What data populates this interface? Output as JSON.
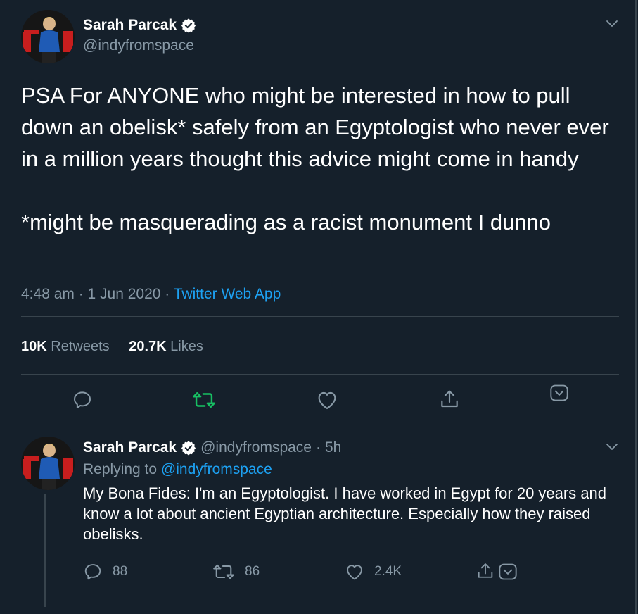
{
  "main_tweet": {
    "author_name": "Sarah Parcak",
    "author_handle": "@indyfromspace",
    "text_paragraph_1": "PSA For ANYONE who might be interested in how to pull down an obelisk* safely from an Egyptologist who never ever in a million years thought this advice might come in handy",
    "text_paragraph_2": "*might be masquerading as a racist monument I dunno",
    "timestamp": "4:48 am · 1 Jun 2020",
    "separator": " · ",
    "source": "Twitter Web App",
    "retweets_count": "10K",
    "retweets_label": "Retweets",
    "likes_count": "20.7K",
    "likes_label": "Likes"
  },
  "reply_tweet": {
    "author_name": "Sarah Parcak",
    "author_handle": "@indyfromspace",
    "dot": "·",
    "time": "5h",
    "replying_label": "Replying to",
    "replying_to": "@indyfromspace",
    "text": "My Bona Fides: I'm an Egyptologist. I have worked in Egypt for 20 years and know a lot about ancient Egyptian architecture. Especially how they raised obelisks.",
    "reply_count": "88",
    "retweet_count": "86",
    "like_count": "2.4K"
  },
  "colors": {
    "background": "#15202b",
    "secondary_text": "#8899a6",
    "link": "#1da1f2",
    "retweeted_green": "#17bf63",
    "divider": "#38444d"
  },
  "icons": [
    "verified-badge-icon",
    "chevron-down-icon",
    "reply-icon",
    "retweet-icon",
    "like-icon",
    "share-icon"
  ]
}
